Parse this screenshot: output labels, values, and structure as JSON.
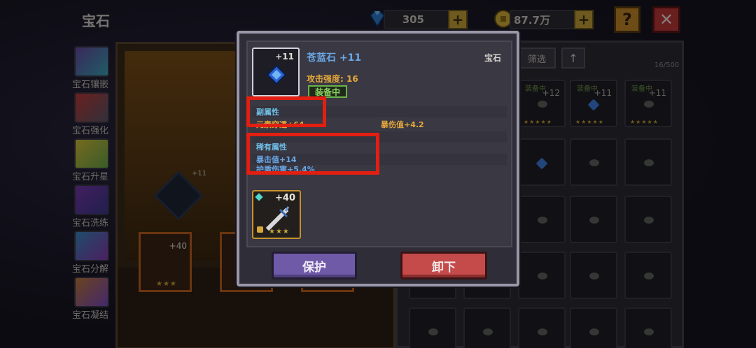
{
  "header": {
    "title": "宝石",
    "diamonds": "305",
    "gold": "87.7万",
    "plus_label": "+",
    "help_label": "?",
    "close_label": "✕"
  },
  "sidebar": {
    "items": [
      {
        "label": "宝石镶嵌",
        "icon": "egg-gem-icon"
      },
      {
        "label": "宝石强化",
        "icon": "hammer-icon"
      },
      {
        "label": "宝石升星",
        "icon": "star-icon"
      },
      {
        "label": "宝石洗练",
        "icon": "wash-gem-icon"
      },
      {
        "label": "宝石分解",
        "icon": "decompose-icon"
      },
      {
        "label": "宝石凝结",
        "icon": "condense-icon"
      }
    ]
  },
  "background_slots": {
    "gem_level": "+11",
    "weapon_level": "+40",
    "stars": "★★★"
  },
  "inventory": {
    "filter_label": "筛选",
    "sort_label": "↑",
    "count": "16/500",
    "equip_tag": "装备中",
    "cells": [
      {
        "tag": "装备中",
        "level": "+12",
        "stars": "★★★★★"
      },
      {
        "tag": "装备中",
        "level": "+11",
        "stars": "★★★★★"
      },
      {
        "tag": "装备中",
        "level": "+11",
        "stars": "★★★★★"
      }
    ]
  },
  "modal": {
    "item_level": "+11",
    "item_name": "苍蓝石 +11",
    "item_type": "宝石",
    "attack": "攻击强度: 16",
    "equipped": "装备中",
    "sub_title": "副属性",
    "sub_attr_1": "元素穿透+64",
    "sub_attr_2": "暴伤值+4.2",
    "rare_title": "稀有属性",
    "rare_attr_1": "暴击值+14",
    "rare_attr_2": "护盾伤害+5.4%",
    "weapon_level": "+40",
    "weapon_stars": "★★★",
    "protect_label": "保护",
    "unequip_label": "卸下"
  },
  "colors": {
    "highlight": "#e21f10",
    "gem_blue": "#3f7fe0",
    "gold_text": "#e6a83a"
  }
}
